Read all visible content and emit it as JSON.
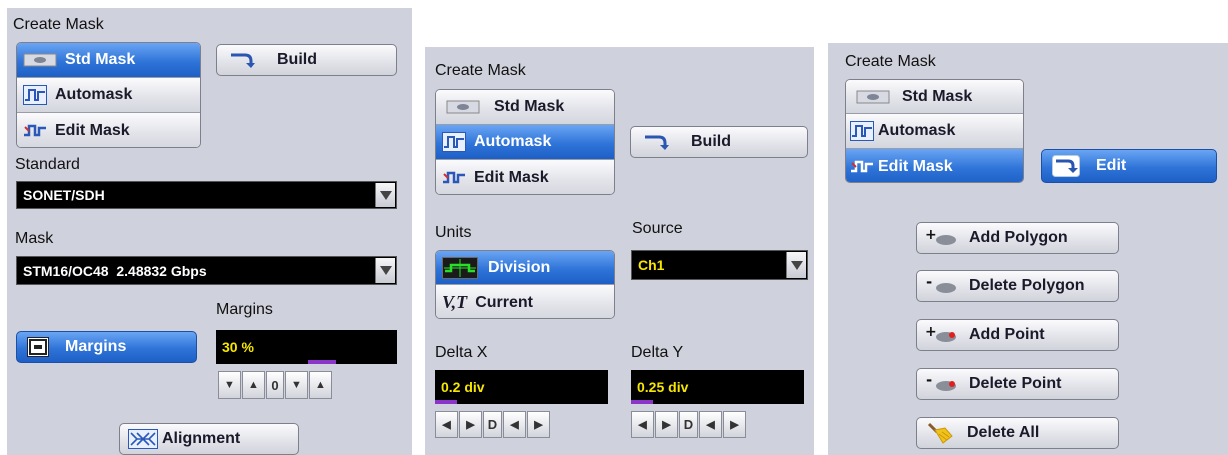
{
  "panel1": {
    "title": "Create Mask",
    "modes": [
      {
        "label": "Std Mask",
        "icon": "std-mask-icon"
      },
      {
        "label": "Automask",
        "icon": "automask-icon"
      },
      {
        "label": "Edit Mask",
        "icon": "edit-mask-icon"
      }
    ],
    "build_label": "Build",
    "standard_label": "Standard",
    "standard_value": "SONET/SDH",
    "mask_label": "Mask",
    "mask_value": "STM16/OC48  2.48832 Gbps",
    "margins_heading": "Margins",
    "margins_button": "Margins",
    "margins_value": "30 %",
    "margins_zero": "0",
    "alignment_label": "Alignment"
  },
  "panel2": {
    "title": "Create Mask",
    "modes": [
      {
        "label": "Std Mask"
      },
      {
        "label": "Automask"
      },
      {
        "label": "Edit Mask"
      }
    ],
    "build_label": "Build",
    "units_label": "Units",
    "units_options": [
      {
        "label": "Division"
      },
      {
        "label": "Current"
      }
    ],
    "current_glyph": "V,T",
    "source_label": "Source",
    "source_value": "Ch1",
    "delta_x_label": "Delta X",
    "delta_x_value": "0.2 div",
    "delta_y_label": "Delta Y",
    "delta_y_value": "0.25 div",
    "d_label": "D"
  },
  "panel3": {
    "title": "Create Mask",
    "modes": [
      {
        "label": "Std Mask"
      },
      {
        "label": "Automask"
      },
      {
        "label": "Edit Mask"
      }
    ],
    "edit_label": "Edit",
    "actions": [
      {
        "label": "Add Polygon"
      },
      {
        "label": "Delete Polygon"
      },
      {
        "label": "Add Point"
      },
      {
        "label": "Delete Point"
      },
      {
        "label": "Delete All"
      }
    ]
  },
  "colors": {
    "panel_bg": "#cfd1dc",
    "active_blue": "#2f74d8",
    "field_text": "#f6e600",
    "indicator": "#8a35c8"
  }
}
